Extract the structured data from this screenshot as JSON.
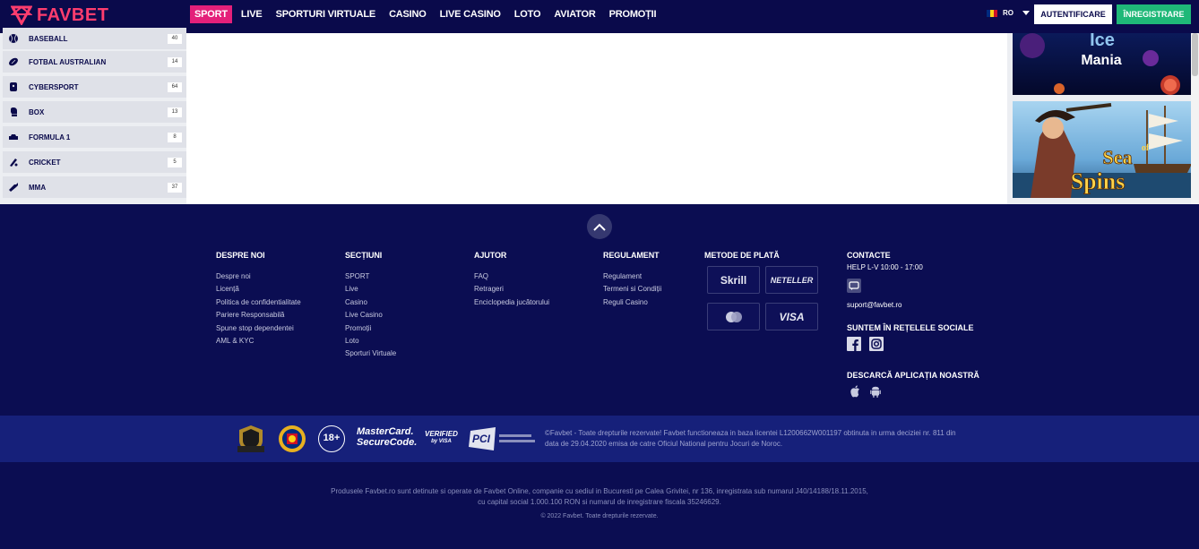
{
  "brand": {
    "name": "FAVBET",
    "color": "#ff3d6e"
  },
  "nav": [
    {
      "label": "SPORT",
      "active": true
    },
    {
      "label": "LIVE"
    },
    {
      "label": "SPORTURI VIRTUALE"
    },
    {
      "label": "CASINO"
    },
    {
      "label": "LIVE CASINO"
    },
    {
      "label": "LOTO"
    },
    {
      "label": "AVIATOR"
    },
    {
      "label": "PROMOȚII"
    }
  ],
  "language": {
    "code": "RO"
  },
  "auth": {
    "login": "AUTENTIFICARE",
    "register": "ÎNREGISTRARE"
  },
  "sports": [
    {
      "label": "BASEBALL",
      "count": "40",
      "icon": "baseball-icon"
    },
    {
      "label": "FOTBAL AUSTRALIAN",
      "count": "14",
      "icon": "australian-football-icon"
    },
    {
      "label": "CYBERSPORT",
      "count": "64",
      "icon": "gamepad-icon"
    },
    {
      "label": "BOX",
      "count": "13",
      "icon": "boxing-glove-icon"
    },
    {
      "label": "FORMULA 1",
      "count": "8",
      "icon": "race-car-icon"
    },
    {
      "label": "CRICKET",
      "count": "5",
      "icon": "cricket-icon"
    },
    {
      "label": "MMA",
      "count": "37",
      "icon": "mma-icon"
    }
  ],
  "promos": [
    {
      "title": "Mania",
      "alt": "Ice"
    },
    {
      "line1": "Sea",
      "line2": "of",
      "line3": "Spins"
    }
  ],
  "footer": {
    "despre": {
      "title": "DESPRE NOI",
      "links": [
        "Despre noi",
        "Licență",
        "Politica de confidentialitate",
        "Pariere Responsabilă",
        "Spune stop dependentei",
        "AML & KYC"
      ]
    },
    "sectiuni": {
      "title": "SECȚIUNI",
      "links": [
        "SPORT",
        "Live",
        "Casino",
        "Live Casino",
        "Promoții",
        "Loto",
        "Sporturi Virtuale"
      ]
    },
    "ajutor": {
      "title": "AJUTOR",
      "links": [
        "FAQ",
        "Retrageri",
        "Enciclopedia jucătorului"
      ]
    },
    "regulament": {
      "title": "REGULAMENT",
      "links": [
        "Regulament",
        "Termeni si Condiții",
        "Reguli Casino"
      ]
    },
    "plata": {
      "title": "METODE DE PLATĂ",
      "methods": [
        "Skrill",
        "NETELLER",
        "",
        "VISA"
      ]
    },
    "contacte": {
      "title": "CONTACTE",
      "hours": "HELP L-V 10:00 - 17:00",
      "email": "suport@favbet.ro"
    },
    "social": {
      "title": "SUNTEM ÎN REȚELELE SOCIALE"
    },
    "app": {
      "title": "DESCARCĂ APLICAȚIA NOASTRĂ"
    }
  },
  "license": {
    "badges": {
      "age": "18+",
      "mastercard_line1": "MasterCard.",
      "mastercard_line2": "SecureCode.",
      "visa_line1": "VERIFIED",
      "visa_line2": "by VISA",
      "pci": "PCI"
    },
    "text": "©Favbet - Toate drepturile rezervate! Favbet functioneaza in baza licentei L1200662W001197 obtinuta in urma deciziei nr. 811 din data de 29.04.2020 emisa de catre Oficiul National pentru Jocuri de Noroc."
  },
  "company": {
    "line1": "Produsele Favbet.ro sunt detinute si operate de Favbet Online, companie cu sediul in Bucuresti pe Calea Grivitei, nr 136, inregistrata sub numarul J40/14188/18.11.2015,",
    "line2": "cu capital social 1.000.100 RON si numarul de inregistrare fiscala 35246629.",
    "copyright": "© 2022 Favbet. Toate drepturile rezervate."
  }
}
